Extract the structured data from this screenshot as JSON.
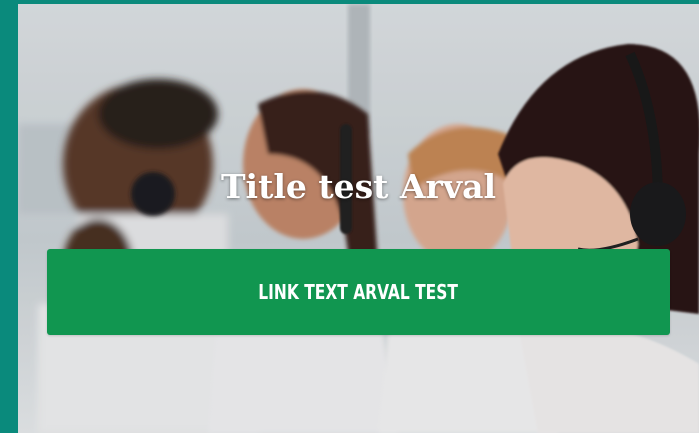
{
  "banner": {
    "title": "Title test Arval",
    "link_text": "LINK TEXT ARVAL TEST",
    "image": "call-center-agents-photo"
  },
  "colors": {
    "frame": "#0a8a7c",
    "button": "#119650",
    "text": "#ffffff"
  }
}
